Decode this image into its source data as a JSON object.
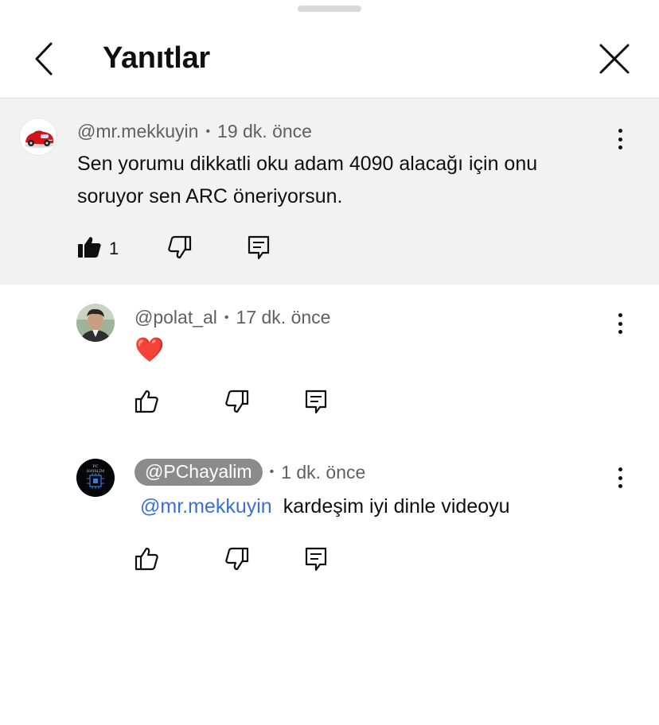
{
  "header": {
    "title": "Yanıtlar",
    "back_icon": "chevron-left-icon",
    "close_icon": "close-icon"
  },
  "comments": [
    {
      "handle": "@mr.mekkuyin",
      "separator": "•",
      "time": "19 dk. önce",
      "text_line1": "Sen yorumu dikkatli oku adam 4090 alacağı için onu",
      "text_line2": "soruyor sen ARC öneriyorsun.",
      "likes": "1",
      "liked": true
    },
    {
      "handle": "@polat_al",
      "separator": "•",
      "time": "17 dk. önce",
      "text": "❤️"
    },
    {
      "handle": "@PChayalim",
      "separator": "•",
      "time": "1 dk. önce",
      "mention": "@mr.mekkuyin",
      "text": "kardeşim iyi dinle videoyu",
      "avatar_label_top": "PC",
      "avatar_label_bottom": "HAYALİM"
    }
  ],
  "colors": {
    "highlight_bg": "#f2f2f2",
    "mention": "#3b6fd4",
    "meta": "#606060",
    "author_pill": "#8b8b8b"
  }
}
